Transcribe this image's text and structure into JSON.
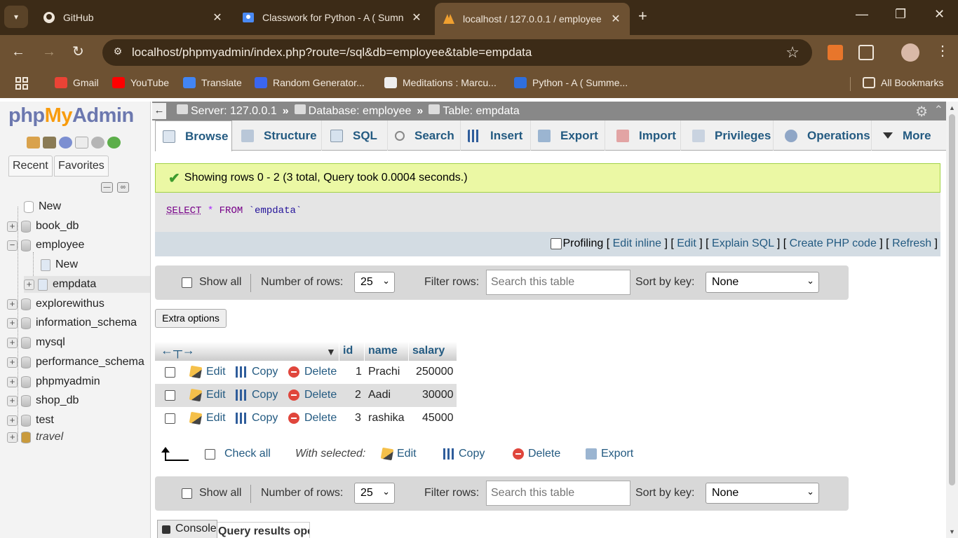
{
  "browser": {
    "tabs": [
      {
        "title": "GitHub",
        "icon": "github-icon"
      },
      {
        "title": "Classwork for Python - A ( Sumn",
        "icon": "classroom-icon"
      },
      {
        "title": "localhost / 127.0.0.1 / employee",
        "icon": "phpmyadmin-icon"
      }
    ],
    "url": "localhost/phpmyadmin/index.php?route=/sql&db=employee&table=empdata",
    "bookmarks": [
      {
        "label": "Gmail",
        "color": "#ea4335"
      },
      {
        "label": "YouTube",
        "color": "#ff0000"
      },
      {
        "label": "Translate",
        "color": "#4285f4"
      },
      {
        "label": "Random Generator...",
        "color": "#3a66f0"
      },
      {
        "label": "Meditations : Marcu...",
        "color": "#eeeeee"
      },
      {
        "label": "Python - A ( Summe...",
        "color": "#2f6fde"
      }
    ],
    "all_bookmarks": "All Bookmarks"
  },
  "nav": {
    "logo": {
      "php": "php",
      "my": "My",
      "admin": "Admin"
    },
    "tabs": [
      "Recent",
      "Favorites"
    ],
    "tree": [
      {
        "label": "New"
      },
      {
        "label": "book_db"
      },
      {
        "label": "employee"
      },
      {
        "label": "New"
      },
      {
        "label": "empdata"
      },
      {
        "label": "explorewithus"
      },
      {
        "label": "information_schema"
      },
      {
        "label": "mysql"
      },
      {
        "label": "performance_schema"
      },
      {
        "label": "phpmyadmin"
      },
      {
        "label": "shop_db"
      },
      {
        "label": "test"
      },
      {
        "label": "travel"
      }
    ]
  },
  "breadcrumb": {
    "server": "Server: 127.0.0.1",
    "database": "Database: employee",
    "table": "Table: empdata",
    "sep": "»"
  },
  "menu": [
    "Browse",
    "Structure",
    "SQL",
    "Search",
    "Insert",
    "Export",
    "Import",
    "Privileges",
    "Operations",
    "More"
  ],
  "message": "Showing rows 0 - 2 (3 total, Query took 0.0004 seconds.)",
  "sql": {
    "kw": "SELECT",
    "star": "*",
    "from": "FROM",
    "table": "`empdata`"
  },
  "sqlopts": {
    "profiling": "Profiling",
    "links": [
      "Edit inline",
      "Edit",
      "Explain SQL",
      "Create PHP code",
      "Refresh"
    ]
  },
  "rowsnav": {
    "show_all": "Show all",
    "num_rows_label": "Number of rows:",
    "num_rows_value": "25",
    "filter_label": "Filter rows:",
    "filter_placeholder": "Search this table",
    "sort_label": "Sort by key:",
    "sort_value": "None"
  },
  "extra_options": "Extra options",
  "grid": {
    "columns": [
      "id",
      "name",
      "salary"
    ],
    "actions": {
      "edit": "Edit",
      "copy": "Copy",
      "delete": "Delete"
    },
    "rows": [
      {
        "id": "1",
        "name": "Prachi",
        "salary": "250000"
      },
      {
        "id": "2",
        "name": "Aadi",
        "salary": "30000"
      },
      {
        "id": "3",
        "name": "rashika",
        "salary": "45000"
      }
    ]
  },
  "bulk": {
    "check_all": "Check all",
    "with_selected": "With selected:",
    "edit": "Edit",
    "copy": "Copy",
    "delete": "Delete",
    "export": "Export"
  },
  "footer": {
    "console": "Console",
    "results_ops": "Query results operations"
  }
}
